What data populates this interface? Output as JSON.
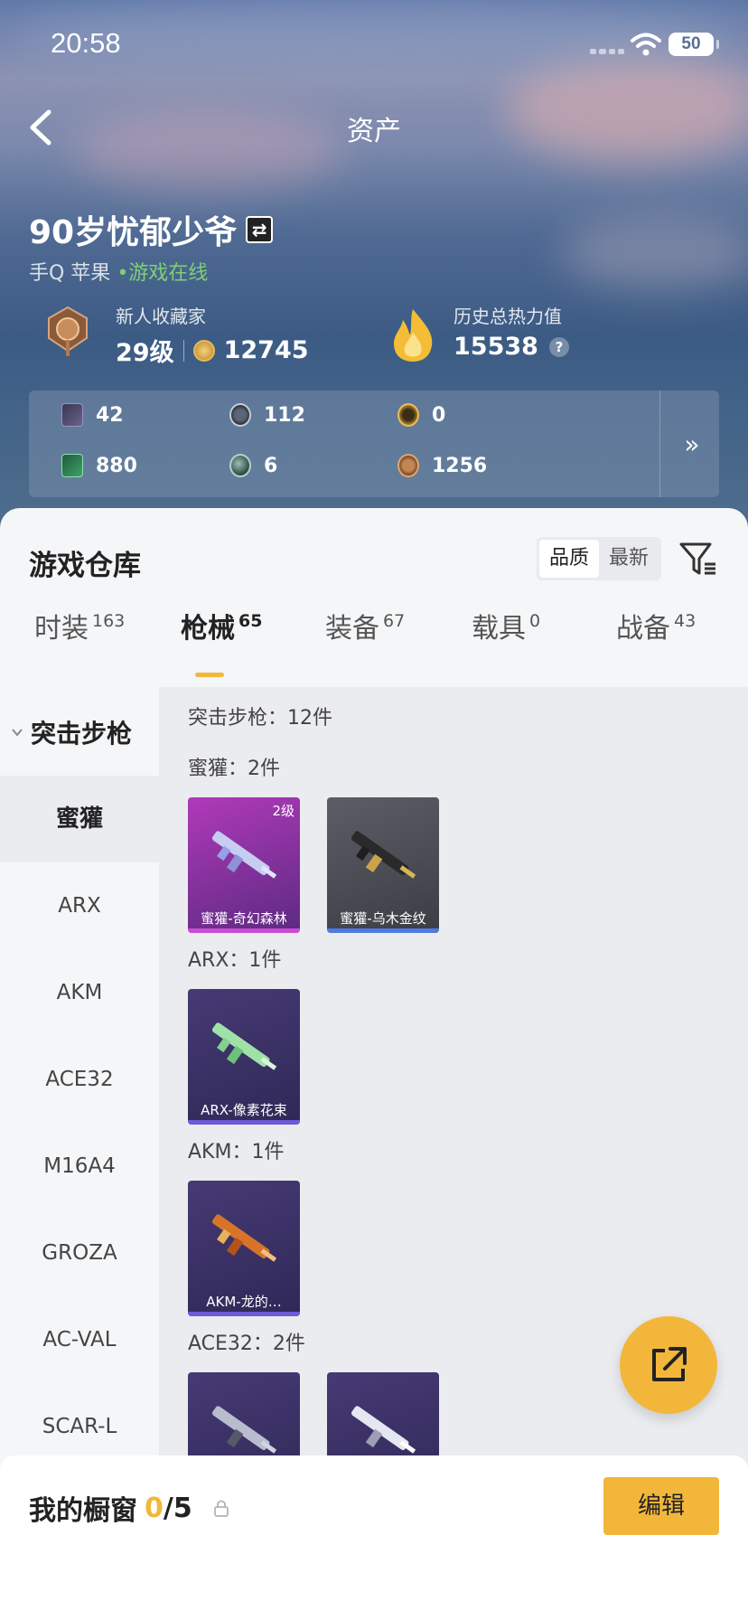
{
  "status": {
    "time": "20:58",
    "battery": "50"
  },
  "header": {
    "title": "资产"
  },
  "profile": {
    "name": "90岁忧郁少爷",
    "platform": "手Q 苹果",
    "online": "游戏在线",
    "collector_label": "新人收藏家",
    "level": "29级",
    "points": "12745",
    "heat_label": "历史总热力值",
    "heat_value": "15538",
    "help": "?"
  },
  "resources": [
    {
      "icon": "card-icon",
      "value": "42"
    },
    {
      "icon": "token-icon",
      "value": "112"
    },
    {
      "icon": "coupon-icon",
      "value": "0"
    },
    {
      "icon": "green-card-icon",
      "value": "880"
    },
    {
      "icon": "orb-icon",
      "value": "6"
    },
    {
      "icon": "bronze-coin-icon",
      "value": "1256"
    }
  ],
  "warehouse": {
    "title": "游戏仓库",
    "sort": [
      "品质",
      "最新"
    ],
    "tabs": [
      {
        "label": "时装",
        "count": "163"
      },
      {
        "label": "枪械",
        "count": "65"
      },
      {
        "label": "装备",
        "count": "67"
      },
      {
        "label": "载具",
        "count": "0"
      },
      {
        "label": "战备",
        "count": "43"
      }
    ],
    "category": "突击步枪",
    "nav": [
      "蜜獾",
      "ARX",
      "AKM",
      "ACE32",
      "M16A4",
      "GROZA",
      "AC-VAL",
      "SCAR-L"
    ],
    "summary": "突击步枪：12件",
    "groups": [
      {
        "title": "蜜獾：2件",
        "items": [
          {
            "name": "蜜獾-奇幻森林",
            "level": "2级"
          },
          {
            "name": "蜜獾-乌木金纹"
          }
        ]
      },
      {
        "title": "ARX：1件",
        "items": [
          {
            "name": "ARX-像素花束"
          }
        ]
      },
      {
        "title": "AKM：1件",
        "items": [
          {
            "name": "AKM-龙的…"
          }
        ]
      },
      {
        "title": "ACE32：2件",
        "items": [
          {},
          {}
        ]
      }
    ]
  },
  "footer": {
    "title": "我的橱窗",
    "count": "0",
    "total": "/5",
    "edit": "编辑"
  },
  "colors": {
    "accent": "#f2b73a",
    "online": "#7fcf76",
    "tier_purple": "#6a5bd6",
    "tier_pink": "#c94bd6",
    "tier_blue": "#4f7be0"
  }
}
